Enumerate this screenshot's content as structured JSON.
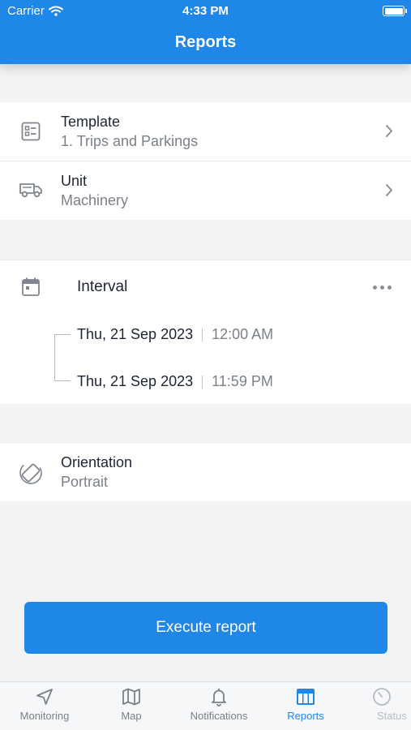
{
  "status_bar": {
    "carrier": "Carrier",
    "time": "4:33 PM"
  },
  "header": {
    "title": "Reports"
  },
  "template": {
    "label": "Template",
    "value": "1. Trips and Parkings"
  },
  "unit": {
    "label": "Unit",
    "value": "Machinery"
  },
  "interval": {
    "label": "Interval",
    "from": {
      "date": "Thu, 21 Sep 2023",
      "time": "12:00 AM"
    },
    "to": {
      "date": "Thu, 21 Sep 2023",
      "time": "11:59 PM"
    }
  },
  "orientation": {
    "label": "Orientation",
    "value": "Portrait"
  },
  "execute_label": "Execute report",
  "tabs": [
    {
      "label": "Monitoring",
      "icon": "navigation-arrow-icon"
    },
    {
      "label": "Map",
      "icon": "map-icon"
    },
    {
      "label": "Notifications",
      "icon": "bell-icon"
    },
    {
      "label": "Reports",
      "icon": "table-icon"
    },
    {
      "label": "Status",
      "icon": "status-gauge-icon"
    }
  ],
  "colors": {
    "accent": "#1e87e8",
    "background": "#f2f3f5"
  }
}
